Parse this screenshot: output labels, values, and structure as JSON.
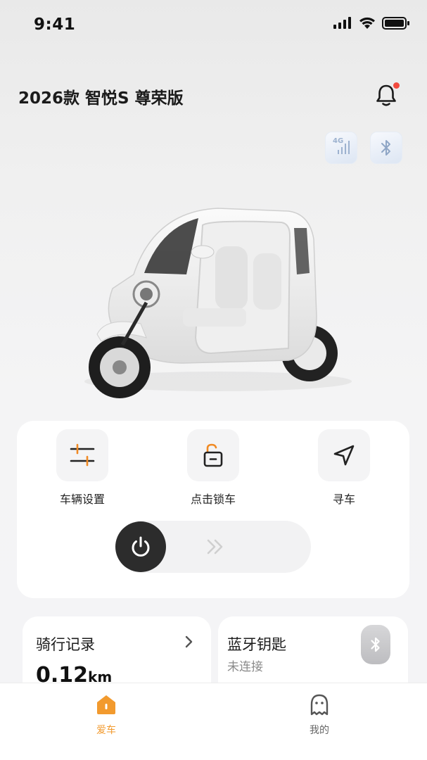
{
  "status_bar": {
    "time": "9:41"
  },
  "header": {
    "title": "2026款 智悦S 尊荣版",
    "has_notification": true
  },
  "connectivity": {
    "network_label": "4G"
  },
  "controls": {
    "vehicle_settings": "车辆设置",
    "lock": "点击锁车",
    "find_car": "寻车"
  },
  "ride_record": {
    "title": "骑行记录",
    "value": "0.12",
    "unit": "km"
  },
  "bluetooth_key": {
    "title": "蓝牙钥匙",
    "status": "未连接"
  },
  "tab_bar": {
    "home": "爱车",
    "me": "我的"
  },
  "colors": {
    "accent": "#f29a2e",
    "alert": "#f24a3e",
    "knob": "#2c2c2c"
  }
}
